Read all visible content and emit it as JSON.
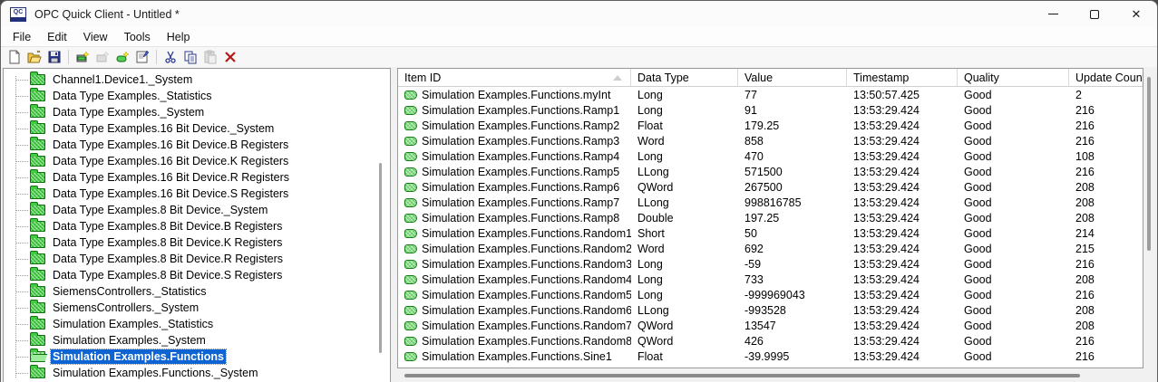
{
  "window": {
    "title": "OPC Quick Client - Untitled *",
    "app_icon_text": "QC"
  },
  "menu": {
    "items": [
      "File",
      "Edit",
      "View",
      "Tools",
      "Help"
    ]
  },
  "toolbar": {
    "buttons": [
      {
        "name": "new-file-icon",
        "disabled": false
      },
      {
        "name": "open-file-icon",
        "disabled": false
      },
      {
        "name": "save-file-icon",
        "disabled": false
      },
      {
        "name": "new-server-connection-icon",
        "disabled": false
      },
      {
        "name": "new-group-icon",
        "disabled": true
      },
      {
        "name": "new-item-icon",
        "disabled": false
      },
      {
        "name": "properties-icon",
        "disabled": false
      },
      {
        "name": "cut-icon",
        "disabled": false
      },
      {
        "name": "copy-icon",
        "disabled": false
      },
      {
        "name": "paste-icon",
        "disabled": true
      },
      {
        "name": "delete-icon",
        "disabled": false
      }
    ]
  },
  "tree": {
    "items": [
      "Channel1.Device1._System",
      "Data Type Examples._Statistics",
      "Data Type Examples._System",
      "Data Type Examples.16 Bit Device._System",
      "Data Type Examples.16 Bit Device.B Registers",
      "Data Type Examples.16 Bit Device.K Registers",
      "Data Type Examples.16 Bit Device.R Registers",
      "Data Type Examples.16 Bit Device.S Registers",
      "Data Type Examples.8 Bit Device._System",
      "Data Type Examples.8 Bit Device.B Registers",
      "Data Type Examples.8 Bit Device.K Registers",
      "Data Type Examples.8 Bit Device.R Registers",
      "Data Type Examples.8 Bit Device.S Registers",
      "SiemensControllers._Statistics",
      "SiemensControllers._System",
      "Simulation Examples._Statistics",
      "Simulation Examples._System"
    ],
    "selected_item": "Simulation Examples.Functions",
    "items_after": [
      "Simulation Examples.Functions._System"
    ]
  },
  "table": {
    "columns": [
      "Item ID",
      "Data Type",
      "Value",
      "Timestamp",
      "Quality",
      "Update Count"
    ],
    "sort": {
      "column": "Item ID",
      "direction": "ascending"
    },
    "rows": [
      {
        "item_id": "Simulation Examples.Functions.myInt",
        "data_type": "Long",
        "value": "77",
        "timestamp": "13:50:57.425",
        "quality": "Good",
        "update_count": "2"
      },
      {
        "item_id": "Simulation Examples.Functions.Ramp1",
        "data_type": "Long",
        "value": "91",
        "timestamp": "13:53:29.424",
        "quality": "Good",
        "update_count": "216"
      },
      {
        "item_id": "Simulation Examples.Functions.Ramp2",
        "data_type": "Float",
        "value": "179.25",
        "timestamp": "13:53:29.424",
        "quality": "Good",
        "update_count": "216"
      },
      {
        "item_id": "Simulation Examples.Functions.Ramp3",
        "data_type": "Word",
        "value": "858",
        "timestamp": "13:53:29.424",
        "quality": "Good",
        "update_count": "216"
      },
      {
        "item_id": "Simulation Examples.Functions.Ramp4",
        "data_type": "Long",
        "value": "470",
        "timestamp": "13:53:29.424",
        "quality": "Good",
        "update_count": "108"
      },
      {
        "item_id": "Simulation Examples.Functions.Ramp5",
        "data_type": "LLong",
        "value": "571500",
        "timestamp": "13:53:29.424",
        "quality": "Good",
        "update_count": "216"
      },
      {
        "item_id": "Simulation Examples.Functions.Ramp6",
        "data_type": "QWord",
        "value": "267500",
        "timestamp": "13:53:29.424",
        "quality": "Good",
        "update_count": "208"
      },
      {
        "item_id": "Simulation Examples.Functions.Ramp7",
        "data_type": "LLong",
        "value": "998816785",
        "timestamp": "13:53:29.424",
        "quality": "Good",
        "update_count": "208"
      },
      {
        "item_id": "Simulation Examples.Functions.Ramp8",
        "data_type": "Double",
        "value": "197.25",
        "timestamp": "13:53:29.424",
        "quality": "Good",
        "update_count": "208"
      },
      {
        "item_id": "Simulation Examples.Functions.Random1",
        "data_type": "Short",
        "value": "50",
        "timestamp": "13:53:29.424",
        "quality": "Good",
        "update_count": "214"
      },
      {
        "item_id": "Simulation Examples.Functions.Random2",
        "data_type": "Word",
        "value": "692",
        "timestamp": "13:53:29.424",
        "quality": "Good",
        "update_count": "215"
      },
      {
        "item_id": "Simulation Examples.Functions.Random3",
        "data_type": "Long",
        "value": "-59",
        "timestamp": "13:53:29.424",
        "quality": "Good",
        "update_count": "216"
      },
      {
        "item_id": "Simulation Examples.Functions.Random4",
        "data_type": "Long",
        "value": "733",
        "timestamp": "13:53:29.424",
        "quality": "Good",
        "update_count": "208"
      },
      {
        "item_id": "Simulation Examples.Functions.Random5",
        "data_type": "Long",
        "value": "-999969043",
        "timestamp": "13:53:29.424",
        "quality": "Good",
        "update_count": "216"
      },
      {
        "item_id": "Simulation Examples.Functions.Random6",
        "data_type": "LLong",
        "value": "-993528",
        "timestamp": "13:53:29.424",
        "quality": "Good",
        "update_count": "208"
      },
      {
        "item_id": "Simulation Examples.Functions.Random7",
        "data_type": "QWord",
        "value": "13547",
        "timestamp": "13:53:29.424",
        "quality": "Good",
        "update_count": "208"
      },
      {
        "item_id": "Simulation Examples.Functions.Random8",
        "data_type": "QWord",
        "value": "426",
        "timestamp": "13:53:29.424",
        "quality": "Good",
        "update_count": "216"
      },
      {
        "item_id": "Simulation Examples.Functions.Sine1",
        "data_type": "Float",
        "value": "-39.9995",
        "timestamp": "13:53:29.424",
        "quality": "Good",
        "update_count": "216"
      }
    ]
  },
  "colors": {
    "selection_blue": "#0d64d2",
    "folder_green": "#43cc43",
    "item_tag_green": "#7ddc7d",
    "delete_red": "#b41818",
    "icon_navy": "#2b3a8f",
    "window_bg": "#f1f1f1"
  }
}
